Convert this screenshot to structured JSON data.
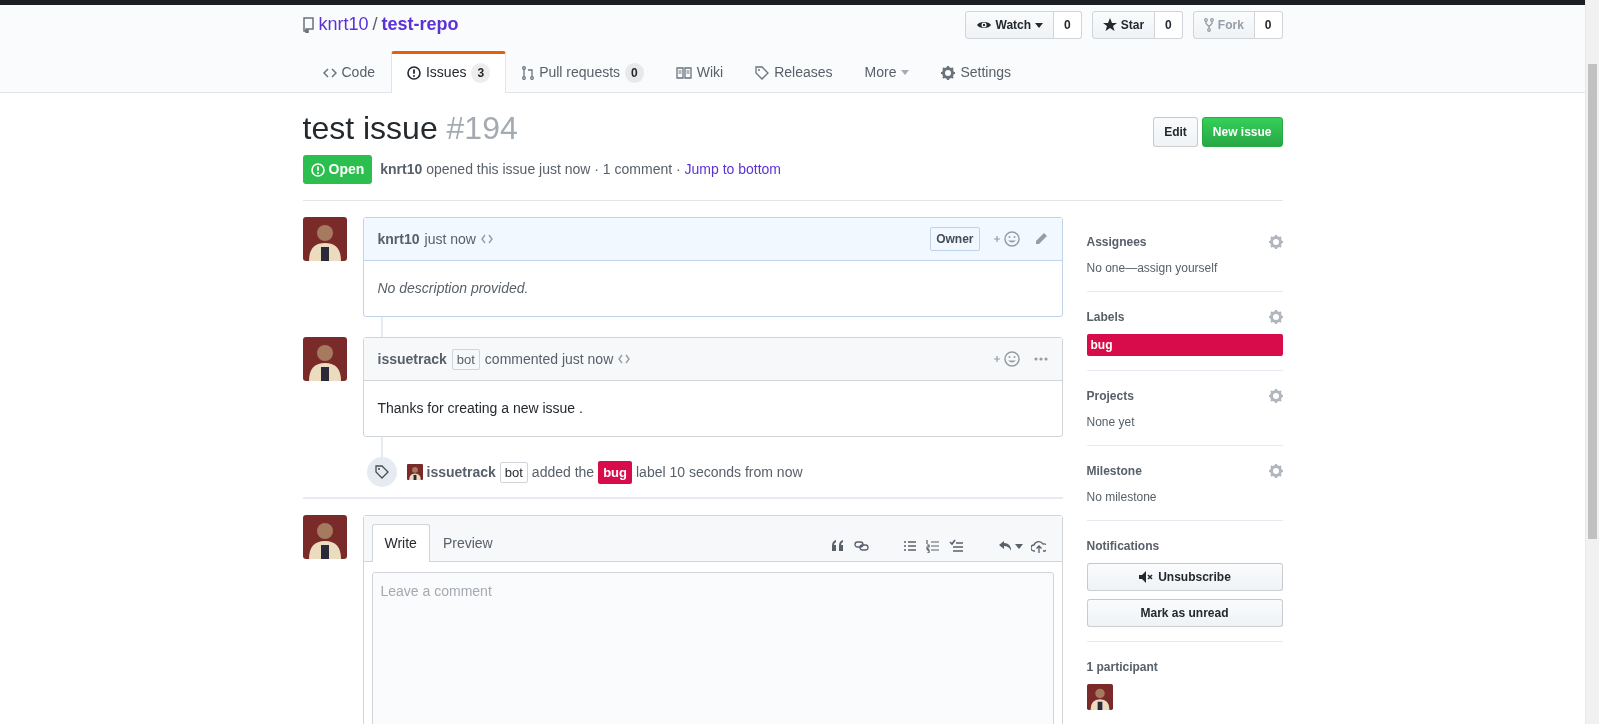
{
  "repo": {
    "owner": "knrt10",
    "separator": "/",
    "name": "test-repo"
  },
  "repo_actions": [
    {
      "kind": "watch",
      "label": "Watch",
      "count": "0",
      "disabled": false
    },
    {
      "kind": "star",
      "label": "Star",
      "count": "0",
      "disabled": false
    },
    {
      "kind": "fork",
      "label": "Fork",
      "count": "0",
      "disabled": true
    }
  ],
  "tabs": [
    {
      "kind": "code",
      "label": "Code",
      "selected": false
    },
    {
      "kind": "issues",
      "label": "Issues",
      "counter": "3",
      "selected": true
    },
    {
      "kind": "pulls",
      "label": "Pull requests",
      "counter": "0",
      "selected": false
    },
    {
      "kind": "wiki",
      "label": "Wiki",
      "selected": false
    },
    {
      "kind": "releases",
      "label": "Releases",
      "selected": false
    },
    {
      "kind": "more",
      "label": "More",
      "selected": false
    },
    {
      "kind": "settings",
      "label": "Settings",
      "selected": false
    }
  ],
  "issue": {
    "title": "test issue",
    "number": "#194",
    "state": "Open",
    "author": "knrt10",
    "meta": "opened this issue just now · 1 comment ·",
    "jump_link": "Jump to bottom"
  },
  "header_buttons": [
    {
      "kind": "edit",
      "label": "Edit"
    },
    {
      "kind": "new",
      "label": "New issue"
    }
  ],
  "timeline": [
    {
      "kind": "comment",
      "author": "knrt10",
      "action": "just now",
      "role": "Owner",
      "highlighted": true,
      "body": "No description provided.",
      "body_empty": true,
      "editable": true
    },
    {
      "kind": "comment",
      "author": "issuetrack",
      "bot_tag": "bot",
      "action": "commented just now",
      "highlighted": false,
      "body": "Thanks for creating a new issue .",
      "body_empty": false,
      "editable": false
    },
    {
      "kind": "event",
      "actor": "issuetrack",
      "bot_tag": "bot",
      "text_before": "added the",
      "label": {
        "name": "bug",
        "color": "#d80b4b"
      },
      "text_after": "label 10 seconds from now"
    }
  ],
  "editor": {
    "tabs": [
      {
        "label": "Write",
        "selected": true
      },
      {
        "label": "Preview",
        "selected": false
      }
    ],
    "placeholder": "Leave a comment"
  },
  "sidebar": [
    {
      "kind": "text",
      "title": "Assignees",
      "gear": true,
      "text": "No one—assign yourself"
    },
    {
      "kind": "labels",
      "title": "Labels",
      "gear": true,
      "labels": [
        {
          "name": "bug",
          "color": "#d80b4b"
        }
      ]
    },
    {
      "kind": "text",
      "title": "Projects",
      "gear": true,
      "text": "None yet"
    },
    {
      "kind": "text",
      "title": "Milestone",
      "gear": true,
      "text": "No milestone"
    },
    {
      "kind": "buttons",
      "title": "Notifications",
      "gear": false,
      "buttons": [
        {
          "kind": "unsubscribe",
          "label": "Unsubscribe"
        },
        {
          "kind": "plain",
          "label": "Mark as unread"
        }
      ]
    },
    {
      "kind": "participants",
      "title": "1 participant",
      "gear": false,
      "participants": [
        {
          "kind": "avatar"
        }
      ]
    }
  ]
}
